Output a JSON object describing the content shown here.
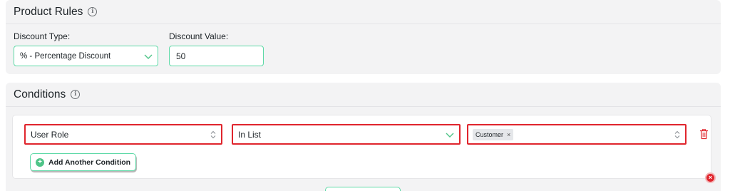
{
  "product_rules": {
    "title": "Product Rules",
    "info_icon": "info-icon",
    "discount_type": {
      "label": "Discount Type:",
      "value": "% - Percentage Discount"
    },
    "discount_value": {
      "label": "Discount Value:",
      "value": "50"
    }
  },
  "conditions": {
    "title": "Conditions",
    "info_icon": "info-icon",
    "rows": [
      {
        "field": "User Role",
        "operator": "In List",
        "values": [
          {
            "label": "Customer",
            "remove": "×"
          }
        ]
      }
    ],
    "add_button": "Add Another Condition"
  },
  "colors": {
    "accent_green": "#5cd9a6",
    "highlight_red": "#e0252d",
    "panel_bg": "#f3f3f4"
  }
}
